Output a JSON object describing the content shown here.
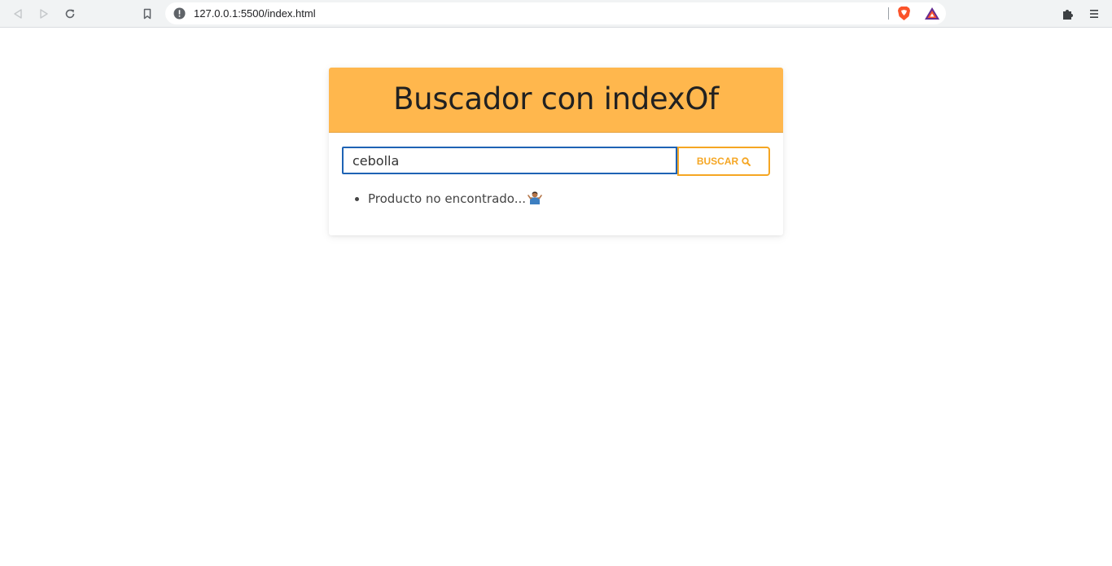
{
  "browser": {
    "url": "127.0.0.1:5500/index.html",
    "icons": [
      "back-icon",
      "forward-icon",
      "reload-icon",
      "bookmark-icon",
      "info-icon",
      "brave-shield-icon",
      "brave-rewards-icon",
      "extensions-icon",
      "menu-icon"
    ]
  },
  "app": {
    "title": "Buscador con indexOf",
    "accent_color": "#ffb74d",
    "button_color": "#f5a623"
  },
  "search": {
    "value": "cebolla",
    "button_label": "BUSCAR",
    "button_icon": "search-icon"
  },
  "results": {
    "items": [
      {
        "text": "Producto no encontrado...",
        "icon": "person-shrugging-icon"
      }
    ]
  }
}
